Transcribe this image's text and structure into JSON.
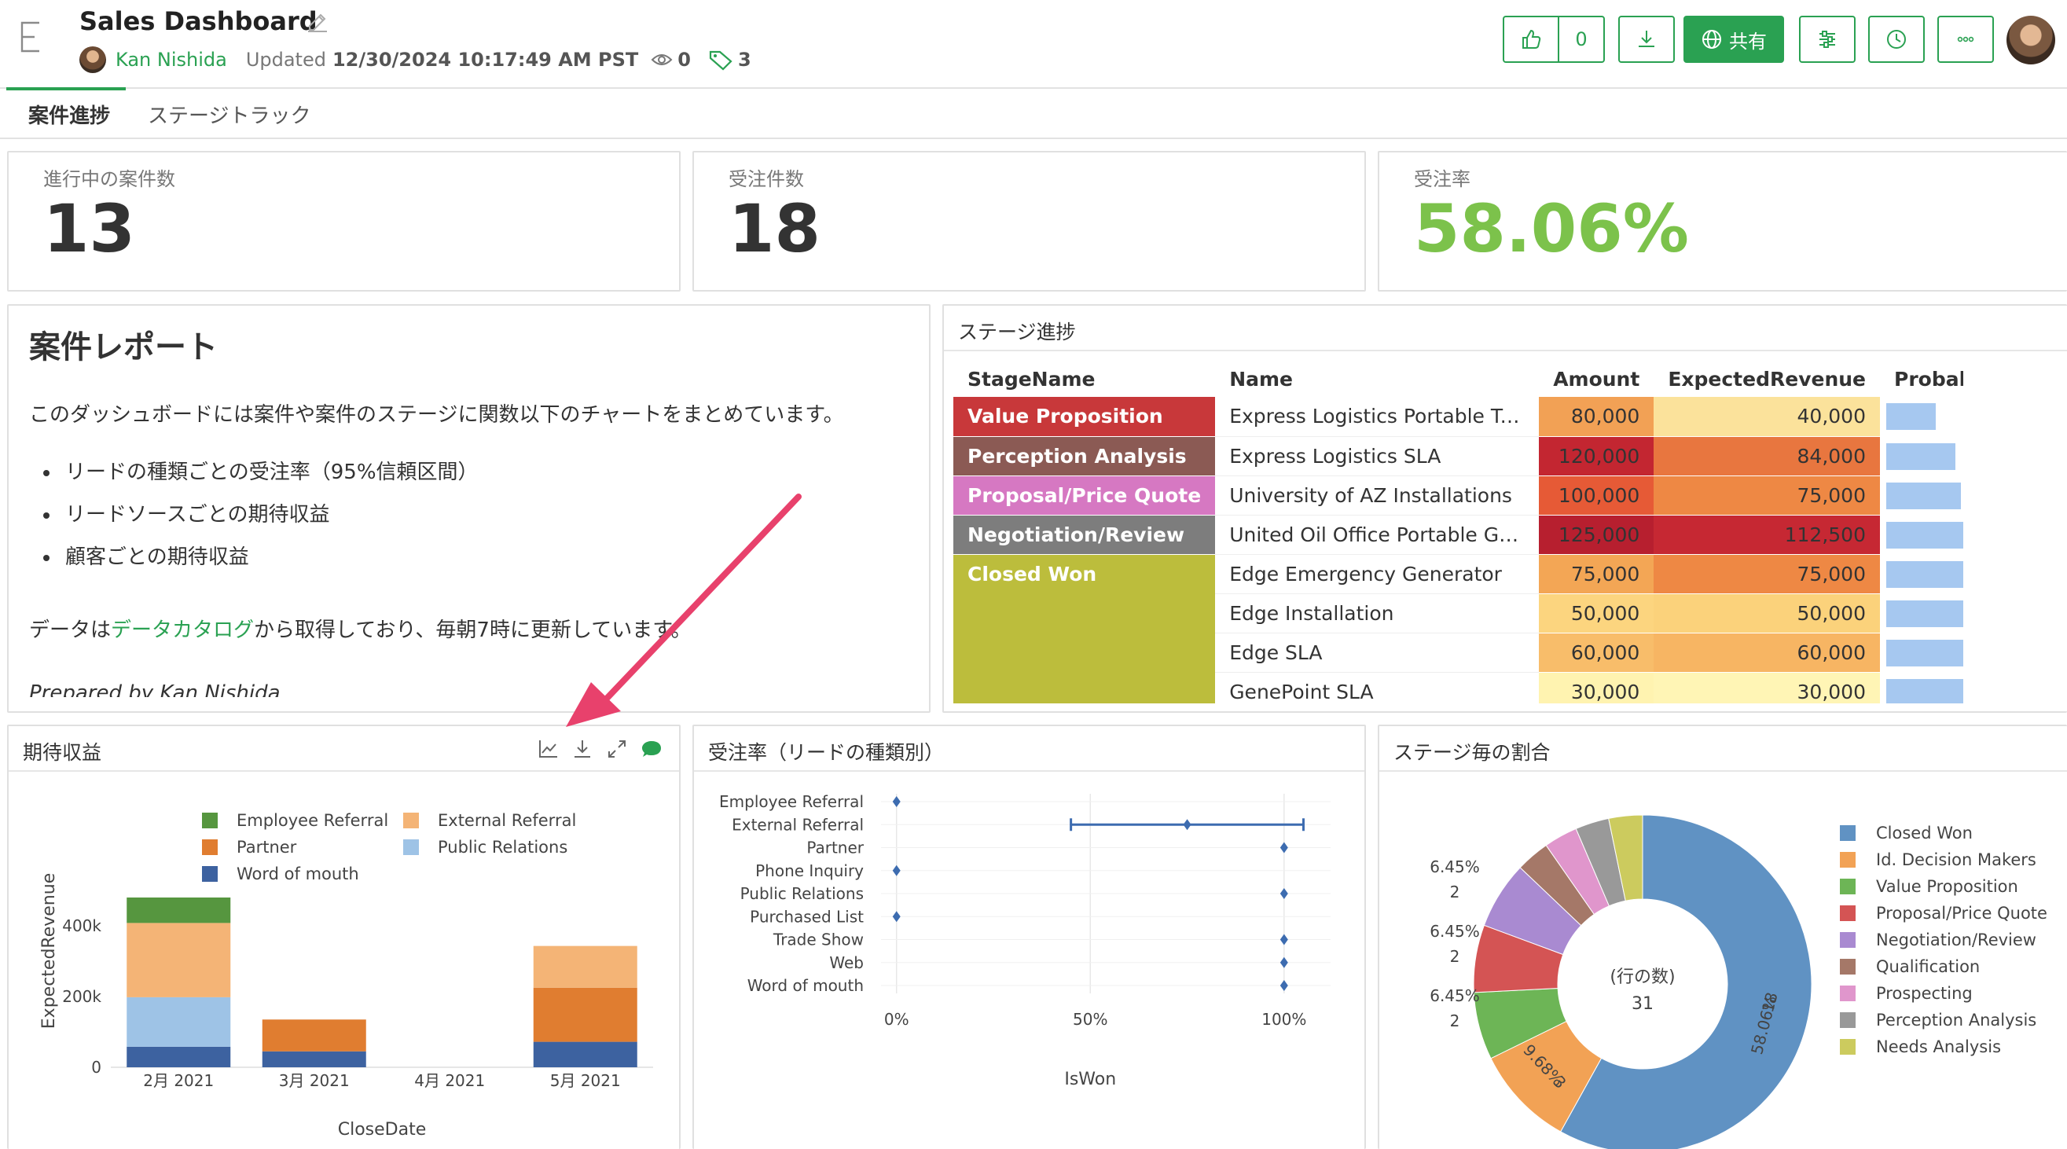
{
  "header": {
    "title": "Sales Dashboard",
    "owner": "Kan Nishida",
    "updated_label": "Updated",
    "updated_value": "12/30/2024 10:17:49 AM PST",
    "views": "0",
    "tags": "3",
    "like_count": "0",
    "share_label": "共有"
  },
  "tabs": [
    {
      "label": "案件進捗",
      "active": true
    },
    {
      "label": "ステージトラック",
      "active": false
    }
  ],
  "kpis": [
    {
      "label": "進行中の案件数",
      "value": "13"
    },
    {
      "label": "受注件数",
      "value": "18"
    },
    {
      "label": "受注率",
      "value": "58.06%"
    }
  ],
  "report": {
    "title": "案件レポート",
    "intro": "このダッシュボードには案件や案件のステージに関数以下のチャートをまとめています。",
    "bullets": [
      "リードの種類ごとの受注率（95%信頼区間）",
      "リードソースごとの期待収益",
      "顧客ごとの期待収益"
    ],
    "data_prefix": "データは",
    "data_link": "データカタログ",
    "data_suffix": "から取得しており、毎朝7時に更新しています。",
    "signature": "Prepared by Kan Nishida"
  },
  "stage_table": {
    "title": "ステージ進捗",
    "columns": [
      "StageName",
      "Name",
      "Amount",
      "ExpectedRevenue",
      "Probability"
    ],
    "rows": [
      {
        "stage": "Value Proposition",
        "stage_color": "#c8383a",
        "name": "Express Logistics Portable Truck ...",
        "amount": "80,000",
        "amount_color": "#f2a155",
        "expected": "40,000",
        "expected_color": "#fbe29b",
        "prob": "50",
        "prob_pct": 50
      },
      {
        "stage": "Perception Analysis",
        "stage_color": "#8b5a54",
        "name": "Express Logistics SLA",
        "amount": "120,000",
        "amount_color": "#c32631",
        "expected": "84,000",
        "expected_color": "#e8763f",
        "prob": "70",
        "prob_pct": 70
      },
      {
        "stage": "Proposal/Price Quote",
        "stage_color": "#d678c2",
        "name": "University of AZ Installations",
        "amount": "100,000",
        "amount_color": "#e65a36",
        "expected": "75,000",
        "expected_color": "#ee8844",
        "prob": "75",
        "prob_pct": 75
      },
      {
        "stage": "Negotiation/Review",
        "stage_color": "#7d7d7d",
        "name": "United Oil Office Portable Generat...",
        "amount": "125,000",
        "amount_color": "#b71f2f",
        "expected": "112,500",
        "expected_color": "#c62833",
        "prob": "90",
        "prob_pct": 90
      },
      {
        "stage": "Closed Won",
        "stage_color": "#bcbd3c",
        "name": "Edge Emergency Generator",
        "amount": "75,000",
        "amount_color": "#f3a655",
        "expected": "75,000",
        "expected_color": "#ee8844",
        "prob": "100",
        "prob_pct": 100
      },
      {
        "stage": "",
        "stage_color": "#bcbd3c",
        "name": "Edge Installation",
        "amount": "50,000",
        "amount_color": "#fcd57f",
        "expected": "50,000",
        "expected_color": "#fbd27b",
        "prob": "100",
        "prob_pct": 100
      },
      {
        "stage": "",
        "stage_color": "#bcbd3c",
        "name": "Edge SLA",
        "amount": "60,000",
        "amount_color": "#f8bd6a",
        "expected": "60,000",
        "expected_color": "#f7b563",
        "prob": "100",
        "prob_pct": 100
      },
      {
        "stage": "",
        "stage_color": "#bcbd3c",
        "name": "GenePoint SLA",
        "amount": "30,000",
        "amount_color": "#fff3b0",
        "expected": "30,000",
        "expected_color": "#fff5b5",
        "prob": "100",
        "prob_pct": 100
      }
    ]
  },
  "charts": {
    "revenue_title": "期待収益",
    "winrate_title": "受注率（リードの種類別）",
    "stage_share_title": "ステージ毎の割合"
  },
  "chart_data": [
    {
      "type": "bar",
      "stacked": true,
      "categories": [
        "2月 2021",
        "3月 2021",
        "4月 2021",
        "5月 2021"
      ],
      "series": [
        {
          "name": "Word of mouth",
          "color": "#3d62a0",
          "values": [
            58000,
            45000,
            0,
            72000
          ]
        },
        {
          "name": "Public Relations",
          "color": "#9ec3e6",
          "values": [
            140000,
            0,
            0,
            0
          ]
        },
        {
          "name": "Partner",
          "color": "#e07d30",
          "values": [
            0,
            90000,
            0,
            153000
          ]
        },
        {
          "name": "External Referral",
          "color": "#f4b476",
          "values": [
            210000,
            0,
            0,
            118000
          ]
        },
        {
          "name": "Employee Referral",
          "color": "#56963f",
          "values": [
            72000,
            0,
            0,
            0
          ]
        }
      ],
      "legend_order": [
        "Employee Referral",
        "External Referral",
        "Partner",
        "Public Relations",
        "Word of mouth"
      ],
      "xlabel": "CloseDate",
      "ylabel": "ExpectedRevenue",
      "yticks": [
        0,
        200000,
        400000
      ],
      "ytick_labels": [
        "0",
        "200k",
        "400k"
      ],
      "ylim": [
        0,
        480000
      ],
      "legend_position": "top"
    },
    {
      "type": "scatter",
      "orientation": "horizontal",
      "categories": [
        "Employee Referral",
        "External Referral",
        "Partner",
        "Phone Inquiry",
        "Public Relations",
        "Purchased List",
        "Trade Show",
        "Web",
        "Word of mouth"
      ],
      "values": [
        0,
        0.75,
        1,
        0,
        1,
        0,
        1,
        1,
        1
      ],
      "error_bars": [
        null,
        [
          0.45,
          1.05
        ],
        null,
        null,
        null,
        null,
        null,
        null,
        null
      ],
      "color": "#3d6cb0",
      "xlabel": "IsWon",
      "xticks": [
        0,
        0.5,
        1
      ],
      "xtick_labels": [
        "0%",
        "50%",
        "100%"
      ],
      "xlim": [
        -0.04,
        1.12
      ]
    },
    {
      "type": "pie",
      "donut": true,
      "center_label": "(行の数)",
      "center_value": "31",
      "slices": [
        {
          "label": "Closed Won",
          "value": 18,
          "pct": "58.06%",
          "color": "#6092c3"
        },
        {
          "label": "Id. Decision Makers",
          "value": 3,
          "pct": "9.68%",
          "color": "#f2a255"
        },
        {
          "label": "Value Proposition",
          "value": 2,
          "pct": "6.45%",
          "color": "#6db556"
        },
        {
          "label": "Proposal/Price Quote",
          "value": 2,
          "pct": "6.45%",
          "color": "#d45454"
        },
        {
          "label": "Negotiation/Review",
          "value": 2,
          "pct": "6.45%",
          "color": "#a98ad1"
        },
        {
          "label": "Qualification",
          "value": 1,
          "pct": "",
          "color": "#a57868"
        },
        {
          "label": "Prospecting",
          "value": 1,
          "pct": "",
          "color": "#e096cc"
        },
        {
          "label": "Perception Analysis",
          "value": 1,
          "pct": "",
          "color": "#999999"
        },
        {
          "label": "Needs Analysis",
          "value": 1,
          "pct": "",
          "color": "#cccb5e"
        }
      ],
      "legend_position": "right"
    }
  ]
}
